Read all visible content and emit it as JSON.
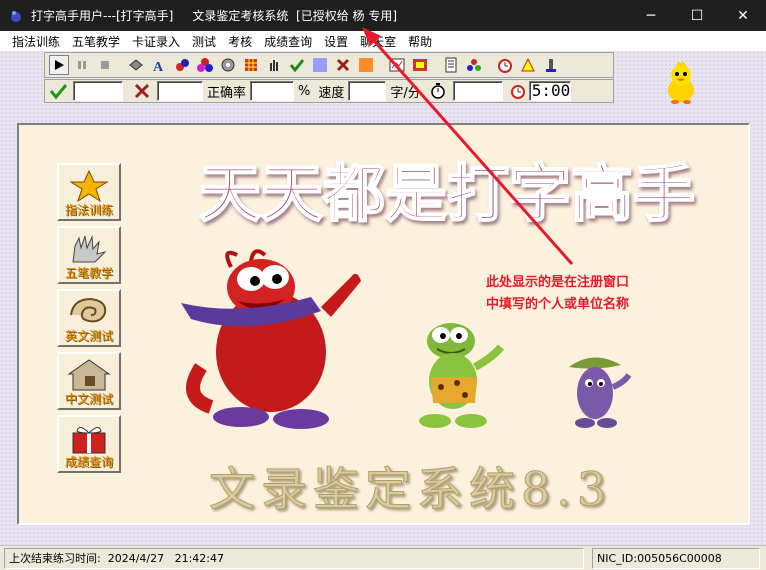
{
  "window": {
    "title": "打字高手用户---[打字高手]     文录鉴定考核系统  [已授权给 杨 专用]",
    "controls": {
      "minimize": "─",
      "maximize": "☐",
      "close": "✕"
    }
  },
  "menu": [
    "指法训练",
    "五笔教学",
    "卡证录入",
    "测试",
    "考核",
    "成绩查询",
    "设置",
    "聊天室",
    "帮助"
  ],
  "toolbar": {
    "icons": [
      "play-icon",
      "pause-icon",
      "stop-icon",
      "book-icon",
      "font-icon",
      "tools-icon",
      "dice-icon",
      "gear-icon",
      "grid-icon",
      "hand-icon",
      "check-icon",
      "square-icon",
      "cross-icon",
      "orange-square-icon",
      "chart-icon",
      "film-icon",
      "keyboard-icon",
      "people-icon",
      "clock-icon",
      "alarm-icon",
      "chess-icon"
    ]
  },
  "stats": {
    "accuracy_label": "正确率",
    "percent_label": "%",
    "speed_label": "速度",
    "speed_unit": "字/分",
    "timer_value": "5:00"
  },
  "nav": [
    {
      "label": "指法训练",
      "icon": "star-icon"
    },
    {
      "label": "五笔教学",
      "icon": "hand-icon"
    },
    {
      "label": "英文测试",
      "icon": "shell-icon"
    },
    {
      "label": "中文测试",
      "icon": "house-icon"
    },
    {
      "label": "成绩查询",
      "icon": "gift-icon"
    }
  ],
  "banner": {
    "top_text": "天天都是打字高手",
    "bottom_text": "文录鉴定系统8.3"
  },
  "annotation": {
    "line1": "此处显示的是在注册窗口",
    "line2": "中填写的个人或单位名称"
  },
  "status": {
    "last_practice": "上次结束练习时间:  2024/4/27   21:42:47",
    "nic": "NIC_ID:005056C00008"
  },
  "colors": {
    "banner_text": "#a0507a",
    "bottom_text": "#d9c89a",
    "annotation": "#e8192c",
    "nav_label": "#e08a00"
  }
}
